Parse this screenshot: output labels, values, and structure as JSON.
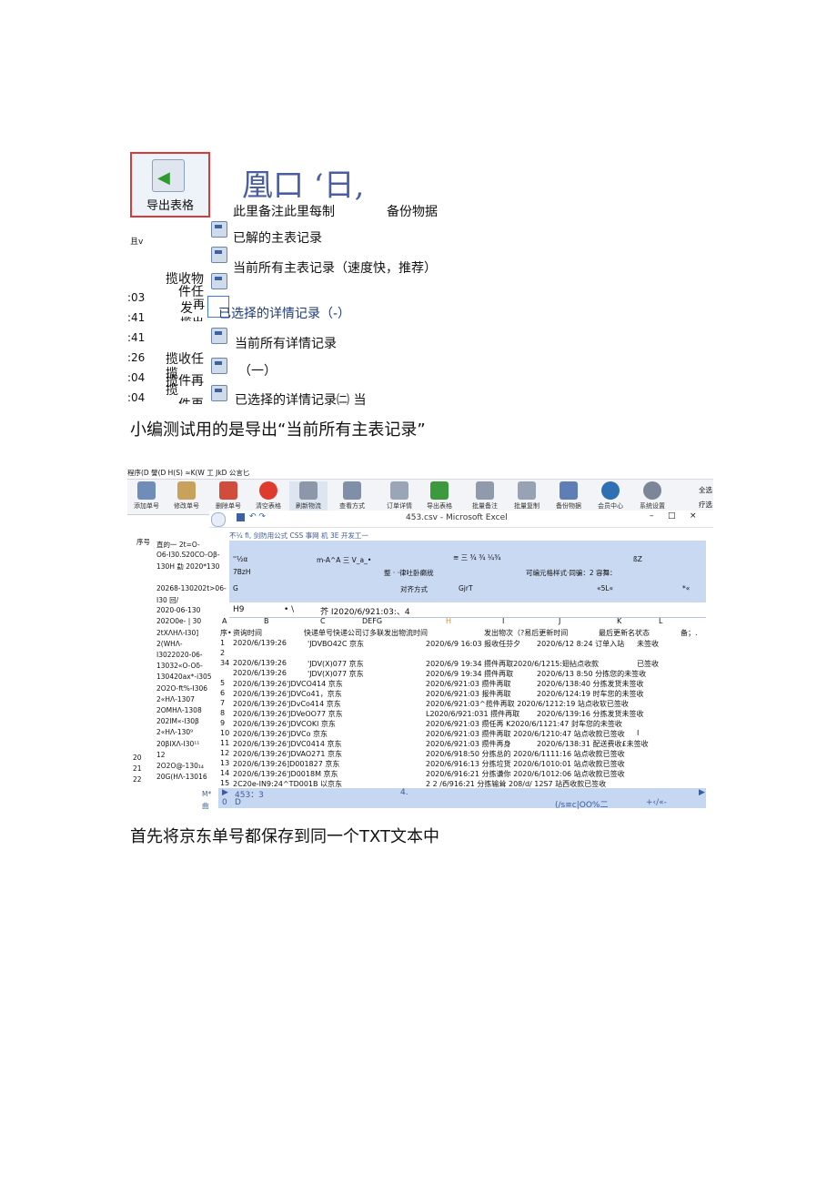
{
  "colors": {
    "accent_red": "#d83a3a",
    "title_blue": "#4a5fa3",
    "ribbon_blue": "#c9d9f2",
    "select_blue": "#3e7bd6"
  },
  "export_button": {
    "label": "导出表格",
    "icon": "export-table-icon"
  },
  "big_title": "凰口 ‘日,",
  "sub_note_left": "此里备注此里每制",
  "sub_note_right": "备份物据",
  "left_label": "且v",
  "menu": {
    "items": [
      {
        "label": "已解的主表记录",
        "icon": "table-save-icon"
      },
      {
        "label": "当前所有主表记录（速度快，推荐）",
        "icon": "table-save-icon"
      },
      {
        "label": "",
        "icon": "table-save-icon"
      },
      {
        "label": "已选择的详情记录（-）",
        "icon": "table-save-icon",
        "selected": true
      },
      {
        "label": "当前所有详情记录",
        "icon": "table-save-icon"
      },
      {
        "label": "（一）",
        "icon": "floppy-icon"
      },
      {
        "label": "已选择的详情记录㈡ 当",
        "icon": "table-save-icon"
      }
    ]
  },
  "left_list": {
    "times": [
      ":03",
      ":41",
      ":41",
      ":26",
      ":04",
      ":04"
    ],
    "texts": [
      "揽收物",
      "件任",
      "发",
      "揽出",
      "揽收任",
      "揽",
      "揽件再",
      "揽",
      "件再"
    ],
    "extra": "再"
  },
  "caption1": "小编测试用的是导出“当前所有主表记录”",
  "caption2": "首先将京东单号都保存到同一个TXT文本中",
  "app_menubar": "程序(D 譬(D H(S) ≈K(W 工 JkD 公言匕",
  "toolbar": {
    "buttons": [
      {
        "label": "添加单号",
        "color": "#6f8db8"
      },
      {
        "label": "修改单号",
        "color": "#c8a25a"
      },
      {
        "label": "删除单号",
        "color": "#d24c3c"
      },
      {
        "label": "清空表格",
        "color": "#e03a2f"
      },
      {
        "label": "刷新物流",
        "color": "#8c98aa"
      },
      {
        "label": "查看方式",
        "color": "#7f8fa8"
      },
      {
        "label": "订单详情",
        "color": "#9aa6b8"
      },
      {
        "label": "导出表格",
        "color": "#3c9a3c"
      },
      {
        "label": "批量备注",
        "color": "#8f9bad"
      },
      {
        "label": "批量复制",
        "color": "#97a3b5"
      },
      {
        "label": "备份物据",
        "color": "#5d7fb5"
      },
      {
        "label": "会员中心",
        "color": "#2f6fb4"
      },
      {
        "label": "系统设置",
        "color": "#7b8798"
      }
    ],
    "right_labels": [
      "全选",
      "疗选"
    ]
  },
  "excel": {
    "title": "453.csv - Microsoft Excel",
    "tabs": "不¼   fi, 剑防用公式 CSS 事网                          机 3E    开发工一",
    "ribbon_row1": [
      "''½α",
      "m-A^A 三 V_a_•",
      "≡ 三 ¾ ¾ ¼¾",
      "ßZ"
    ],
    "ribbon_row2": [
      "7BzH",
      "整 ·  ·律吐卧癞戕",
      "可编元格样式·同骗：2 容舞："
    ],
    "ribbon_row3": [
      "G",
      "对齐方式",
      "GjrT",
      "«5L«",
      "*«"
    ],
    "formula_name": "H9",
    "formula_fx": "• \\",
    "formula_value": "芥 I2020/6/921:03:、4",
    "columns": [
      "A",
      "B",
      "C",
      "DEFG",
      "H",
      "I",
      "J",
      "K",
      "L"
    ],
    "header_row": [
      "序•",
      "资询时间",
      "快递单号快递公司订多联发出物流时间",
      "",
      "发出物次（?易后更新时间",
      "最后更新名状态",
      "备；."
    ],
    "rows": [
      {
        "n": "1",
        "a": "2020/6/139:26",
        "b": "'JDVBO42C 京东",
        "c": "2020/6/9 16:03  报收任芬夕",
        "d": "2020/6/12 8:24  订单入站",
        "e": "未签收"
      },
      {
        "n": "2",
        "a": "",
        "b": "",
        "c": "",
        "d": "",
        "e": ""
      },
      {
        "n": "34",
        "a": "2020/6/139:26",
        "b": "'JDV(X)077 京东",
        "c": "2020/6/9 19:34  攒件再取2020/6/1215:翅拈点收款",
        "d": "",
        "e": "已签收"
      },
      {
        "n": "",
        "a": "2020/6/139:26",
        "b": "'JDV(X)077 京东",
        "c": "2020/6/9 19:34  攒件再取",
        "d": "2020/6/13 8:50  分拣您的未签收",
        "e": ""
      },
      {
        "n": "5",
        "a": "2020/6/139:26'JDVCO414 京东",
        "b": "",
        "c": "2020/6/921:03 攒件再取",
        "d": "2020/6/138:40 分拣发货未签收",
        "e": ""
      },
      {
        "n": "6",
        "a": "2020/6/139:26'JDVCo41，京东",
        "b": "",
        "c": "2020/6/921:03 报件再取",
        "d": "2020/6/124:19 时车您的未签收",
        "e": ""
      },
      {
        "n": "7",
        "a": "2020/6/139:26'JDvCo414 京东",
        "b": "",
        "c": "2020/6/921:03^揽件再取 2020/6/1212:19 站点收软已签收",
        "d": "",
        "e": ""
      },
      {
        "n": "8",
        "a": "2020/6/139:26'JDVeOO77 京东",
        "b": "",
        "c": "L2020/6/921:031 攒件再取",
        "d": "2020/6/139:16 分拣发货未签收",
        "e": ""
      },
      {
        "n": "9",
        "a": "2020/6/139:26'JDVCOKl 京东",
        "b": "",
        "c": "2020/6/921:03 攒任再 K2020/6/1121:47 封车您的未签收",
        "d": "",
        "e": ""
      },
      {
        "n": "10",
        "a": "2020/6/139:26'JDVCo 京东",
        "b": "",
        "c": "2020/6/921:03 攒件再取 2020/6/1210:47 站点收款已签收",
        "d": "",
        "e": "I"
      },
      {
        "n": "11",
        "a": "2020/6/139:26'JDVC0414 京东",
        "b": "",
        "c": "2020/6/921:03 攒件再身",
        "d": "2020/6/138:31 配送费收£未签收",
        "e": ""
      },
      {
        "n": "12",
        "a": "2020/6/139:26'JDVAO271 京东",
        "b": "",
        "c": "2020/6/918:50 分拣总的 2020/6/1111:16 站点收款已签收",
        "d": "",
        "e": ""
      },
      {
        "n": "13",
        "a": "2020/6/139:26]D001827 京东",
        "b": "",
        "c": "2020/6/916:13 分拣垃货 2020/6/1010:01 站点收款已签收",
        "d": "",
        "e": ""
      },
      {
        "n": "14",
        "a": "2020/6/139:26'JD0018M 京东",
        "b": "",
        "c": "2020/6/916:21 分拣谦你 2020/6/1012:06 站点收款已签收",
        "d": "",
        "e": ""
      },
      {
        "n": "15",
        "a": "2C20e-IN9:24^TD001B 以京东",
        "b": "",
        "c": "2    2    /6/916:21 分拣输耸 208/d/    12S7 站西收款已签收",
        "d": "",
        "e": ""
      }
    ],
    "status_left": "453：3",
    "status_mid": "4.",
    "status_bottom_left": "0",
    "status_bottom_mid": "D",
    "status_bottom_right": "(/s≡c|OO%二",
    "status_bottom_far": "+‹/«-"
  },
  "left_table": {
    "header": "序号",
    "lines": [
      "直的一 2t=O-",
      "O6-I30.S20CO-Oβ-",
      "130H 勐 2020*130",
      "",
      "20268-130202t>06-",
      "I30 回/",
      "2020-06-130",
      "202O0e- | 30",
      "2tXΛHΛ-I30]",
      "2(WHΛ-",
      "I3022020-06-",
      "13032«O-Oδ-",
      "130420ax*-i305",
      "2O2O-ft%-I306",
      "2«HΛ-1307",
      "2OMHΛ-1308",
      "202IM«-I30β",
      "2«HΛ-130⁹",
      "20βIXΛ-I30¹¹",
      "12",
      "2O2O@-130₁₄",
      "20G(HΛ-13016"
    ],
    "side_numbers": [
      "20",
      "21",
      "22"
    ],
    "side_marks": [
      "M*",
      "曲"
    ]
  }
}
